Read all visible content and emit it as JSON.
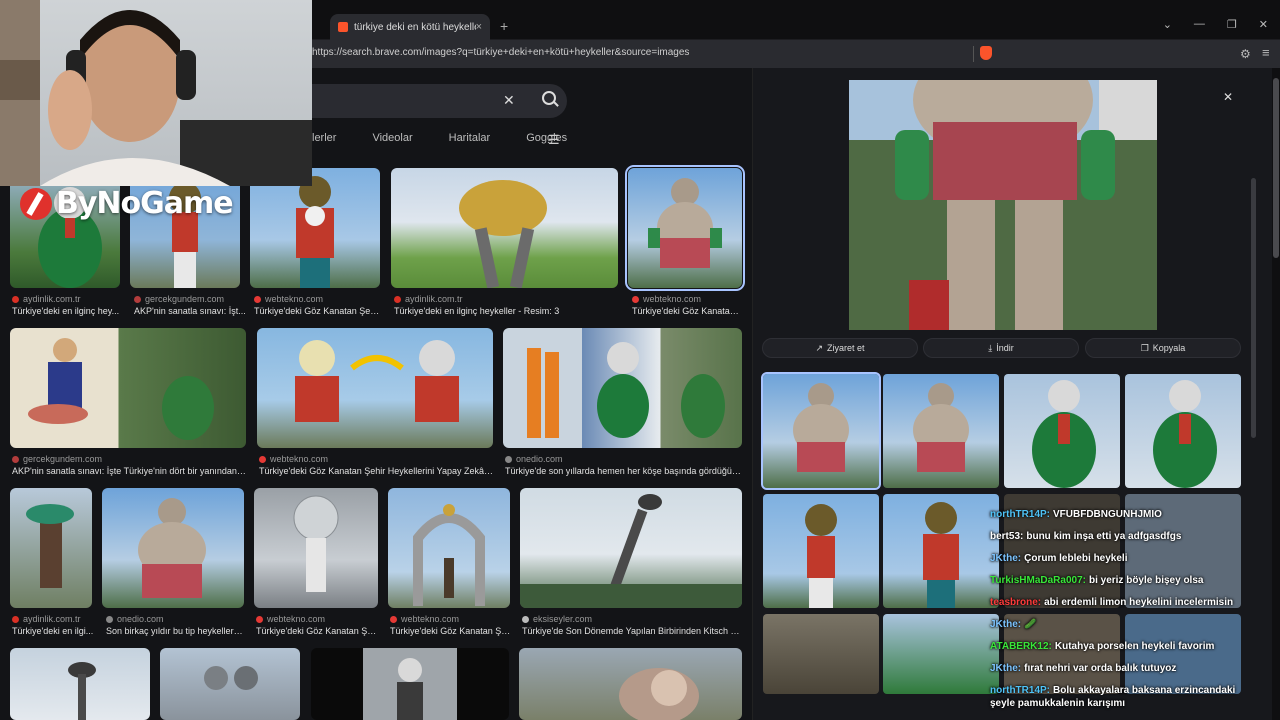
{
  "browser": {
    "tab_title": "türkiye deki en kötü heykeller - B",
    "tab_close": "×",
    "new_tab": "+",
    "url": "https://search.brave.com/images?q=türkiye+deki+en+kötü+heykeller&source=images",
    "window_controls": [
      "⌄",
      "—",
      "❐",
      "✕"
    ]
  },
  "search": {
    "clear": "✕",
    "tabs": [
      "lerler",
      "Videolar",
      "Haritalar",
      "Goggles"
    ]
  },
  "results": [
    {
      "source": "aydinlik.com.tr",
      "title": "Türkiye'deki en ilginç hey..."
    },
    {
      "source": "gercekgundem.com",
      "title": "AKP'nin sanatla sınavı: İşt..."
    },
    {
      "source": "webtekno.com",
      "title": "Türkiye'deki Göz Kanatan Şehir..."
    },
    {
      "source": "aydinlik.com.tr",
      "title": "Türkiye'deki en ilginç heykeller - Resim: 3"
    },
    {
      "source": "webtekno.com",
      "title": "Türkiye'deki Göz Kanatan ..."
    },
    {
      "source": "gercekgundem.com",
      "title": "AKP'nin sanatla sınavı: İşte Türkiye'nin dört bir yanından ilgi..."
    },
    {
      "source": "webtekno.com",
      "title": "Türkiye'deki Göz Kanatan Şehir Heykellerini Yapay Zekâ ile ..."
    },
    {
      "source": "onedio.com",
      "title": "Türkiye'de son yıllarda hemen her köşe başında gördüğümü..."
    },
    {
      "source": "aydinlik.com.tr",
      "title": "Türkiye'deki en ilgi..."
    },
    {
      "source": "onedio.com",
      "title": "Son birkaç yıldır bu tip heykelleri g..."
    },
    {
      "source": "webtekno.com",
      "title": "Türkiye'deki Göz Kanatan Şeh..."
    },
    {
      "source": "webtekno.com",
      "title": "Türkiye'deki Göz Kanatan Şeh..."
    },
    {
      "source": "eksiseyler.com",
      "title": "Türkiye'de Son Dönemde Yapılan Birbirinden Kitsch He..."
    }
  ],
  "preview": {
    "close": "✕",
    "actions": [
      "Ziyaret et",
      "İndir",
      "Kopyala"
    ]
  },
  "overlay": {
    "logo": "ByNoGame"
  },
  "chat": [
    {
      "user": "northTR14P:",
      "text": "VFUBFDBNGUNHJMIO",
      "color": "#4fc3f7"
    },
    {
      "user": "bert53:",
      "text": "bunu kim inşa etti ya adfgasdfgs",
      "color": "#ffffff"
    },
    {
      "user": "JKthe:",
      "text": "Çorum leblebi heykeli",
      "color": "#7cc4ff"
    },
    {
      "user": "TurkisHMaDaRa007:",
      "text": "bi yeriz böyle bişey olsa",
      "color": "#39e639"
    },
    {
      "user": "teasbrone:",
      "text": "abi erdemli limon heykelini incelermisin",
      "color": "#ff3b3b"
    },
    {
      "user": "JKthe:",
      "text": "🥒",
      "color": "#7cc4ff"
    },
    {
      "user": "ATABERK12:",
      "text": "Kutahya porselen heykeli favorim",
      "color": "#39e639"
    },
    {
      "user": "JKthe:",
      "text": "fırat nehri var orda balık tutuyoz",
      "color": "#7cc4ff"
    },
    {
      "user": "northTR14P:",
      "text": "Bolu akkayalara baksana erzincandaki şeyle pamukkalenin karışımı",
      "color": "#4fc3f7"
    }
  ]
}
